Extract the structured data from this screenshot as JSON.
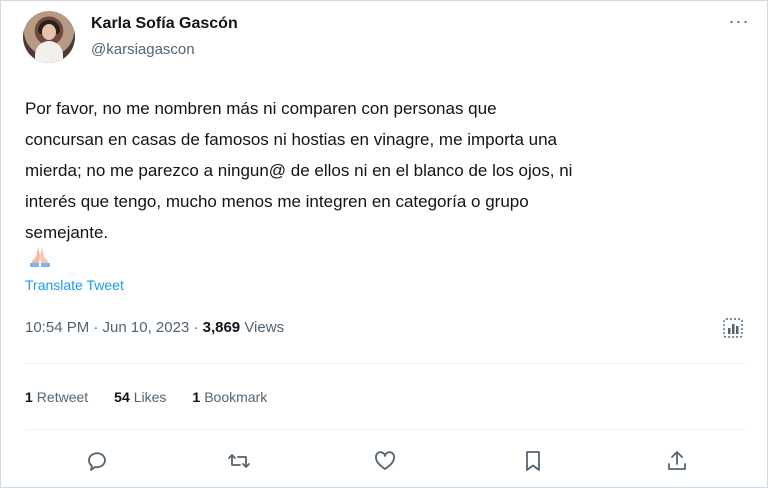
{
  "tweet": {
    "author_name": "Karla Sofía Gascón",
    "author_handle": "@karsiagascon",
    "more_label": "···",
    "text": "Por favor, no me nombren más ni comparen con personas que\nconcursan en casas de famosos ni hostias en vinagre, me importa una\nmierda; no me parezco a ningun@ de ellos ni en el blanco de los ojos, ni\ninterés que tengo, mucho menos me integren en categoría o grupo\nsemejante.",
    "emoji": "folded-hands",
    "translate_label": "Translate Tweet",
    "timestamp": "10:54 PM · Jun 10, 2023 · ",
    "views_count": "3,869",
    "views_label": "Views"
  },
  "stats": {
    "retweets_count": "1",
    "retweets_label": "Retweet",
    "likes_count": "54",
    "likes_label": "Likes",
    "bookmarks_count": "1",
    "bookmarks_label": "Bookmark"
  },
  "actions": {
    "icons": [
      "reply-icon",
      "retweet-icon",
      "like-icon",
      "bookmark-icon",
      "share-icon"
    ]
  },
  "colors": {
    "text": "#0f1419",
    "secondary": "#536471",
    "link": "#1d9bf0",
    "border": "#cfd9de"
  }
}
